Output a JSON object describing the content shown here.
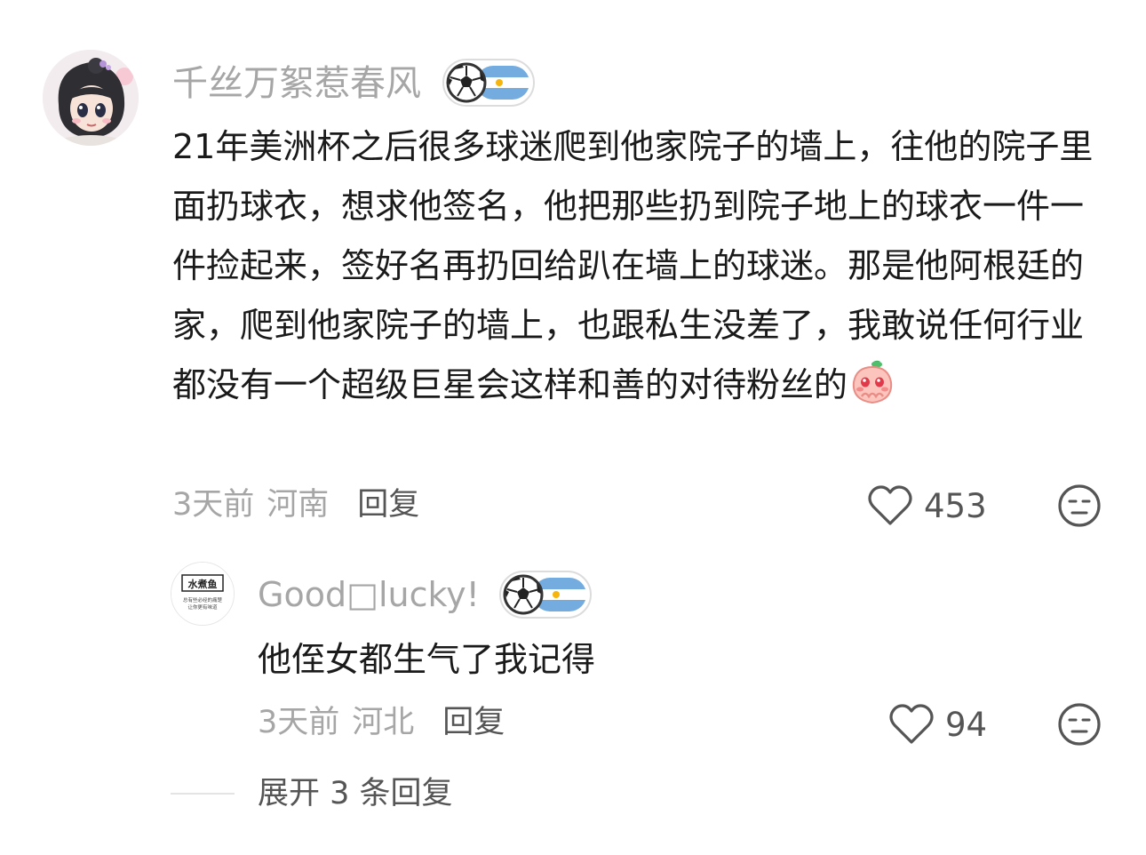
{
  "main_comment": {
    "username": "千丝万絮惹春风",
    "badge_icon": "football-argentina-badge-icon",
    "text": "21年美洲杯之后很多球迷爬到他家院子的墙上，往他的院子里面扔球衣，想求他签名，他把那些扔到院子地上的球衣一件一件捡起来，签好名再扔回给趴在墙上的球迷。那是他阿根廷的家，爬到他家院子的墙上，也跟私生没差了，我敢说任何行业都没有一个超级巨星会这样和善的对待粉丝的",
    "emoji": "crying-peach-emoji",
    "time": "3天前",
    "region": "河南",
    "reply_label": "回复",
    "likes": "453"
  },
  "reply_comment": {
    "username": "Good□lucky!",
    "avatar_text_top": "水煮鱼",
    "avatar_text_bottom_1": "总有些必经的痛楚",
    "avatar_text_bottom_2": "让你更有味道",
    "badge_icon": "football-argentina-badge-icon",
    "text": "他侄女都生气了我记得",
    "time": "3天前",
    "region": "河北",
    "reply_label": "回复",
    "likes": "94"
  },
  "expand_replies": "展开 3 条回复",
  "colors": {
    "muted_text": "#a6a6a6",
    "body_text": "#1a1a1a",
    "action_text": "#555555",
    "argentina_blue": "#74acdf"
  }
}
